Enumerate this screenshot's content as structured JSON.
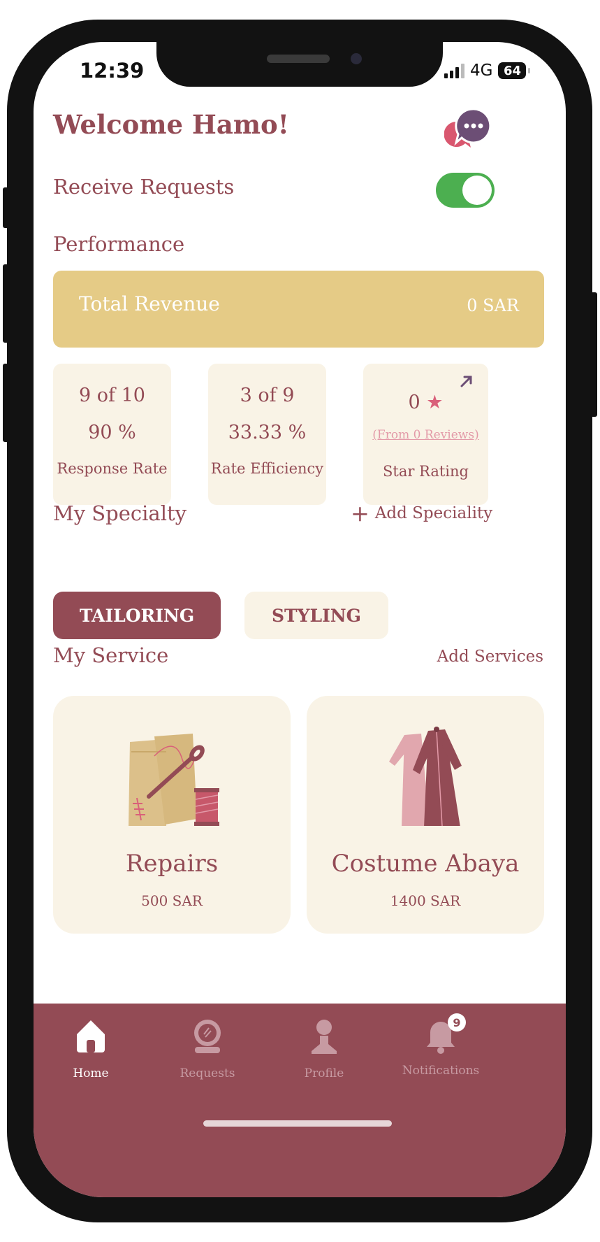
{
  "status_bar": {
    "time": "12:39",
    "network": "4G",
    "battery": "64"
  },
  "header": {
    "welcome": "Welcome Hamo!"
  },
  "receive_requests": {
    "label": "Receive Requests",
    "enabled": true
  },
  "performance": {
    "title": "Performance",
    "revenue_label": "Total Revenue",
    "revenue_value": "0 SAR",
    "stats": [
      {
        "line1": "9 of 10",
        "line2": "90 %",
        "label": "Response Rate"
      },
      {
        "line1": "3 of 9",
        "line2": "33.33 %",
        "label": "Rate Efficiency"
      }
    ],
    "rating": {
      "value": "0",
      "star": "★",
      "reviews": "(From 0 Reviews)",
      "label": "Star Rating"
    }
  },
  "specialty": {
    "title": "My Specialty",
    "add_label": "Add Speciality",
    "chips": [
      "TAILORING",
      "STYLING"
    ]
  },
  "services": {
    "title": "My Service",
    "add_label": "Add Services",
    "items": [
      {
        "name": "Repairs",
        "price": "500 SAR"
      },
      {
        "name": "Costume Abaya",
        "price": "1400 SAR"
      }
    ]
  },
  "tabbar": {
    "items": [
      {
        "label": "Home",
        "icon": "home-icon"
      },
      {
        "label": "Requests",
        "icon": "mirror-icon"
      },
      {
        "label": "Profile",
        "icon": "person-icon"
      },
      {
        "label": "Notifications",
        "icon": "bell-icon"
      }
    ],
    "notifications_badge": "9"
  },
  "colors": {
    "primary": "#934b55",
    "gold": "#e5cb86",
    "cream": "#f9f3e6",
    "toggle_on": "#4caf50"
  }
}
